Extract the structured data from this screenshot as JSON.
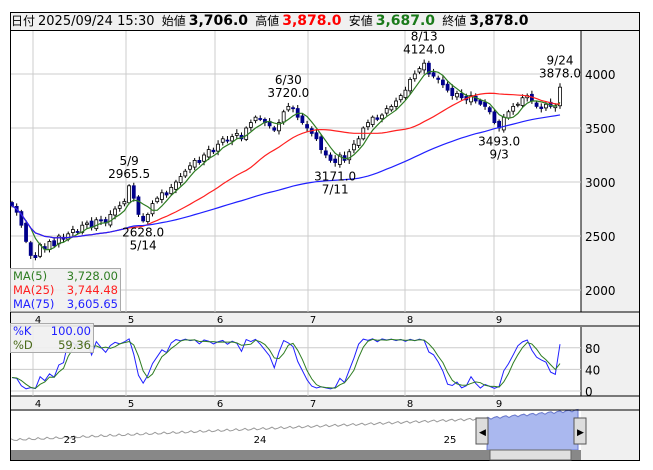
{
  "header": {
    "date_label": "日付",
    "datetime": "2025/09/24 15:30",
    "open_label": "始値",
    "open": "3,706.0",
    "high_label": "高値",
    "high": "3,878.0",
    "low_label": "安値",
    "low": "3,687.0",
    "close_label": "終値",
    "close": "3,878.0"
  },
  "colors": {
    "up_fill": "#ffffff",
    "down_fill": "#00008b",
    "ma5": "#2e7d22",
    "ma25": "#ff2020",
    "ma75": "#2020ff",
    "high_text": "#ff0000",
    "low_text": "#1a7a1a",
    "k": "#2020ff",
    "d": "#2e7d22"
  },
  "legend_ma": [
    {
      "label": "MA(5)",
      "value": "3,728.00"
    },
    {
      "label": "MA(25)",
      "value": "3,744.48"
    },
    {
      "label": "MA(75)",
      "value": "3,605.65"
    }
  ],
  "legend_stoch": [
    {
      "label": "%K",
      "value": "100.00"
    },
    {
      "label": "%D",
      "value": "59.36"
    }
  ],
  "navigator": {
    "years": [
      "23",
      "24",
      "25"
    ]
  },
  "chart_data": {
    "type": "candlestick",
    "months": [
      "4",
      "5",
      "6",
      "7",
      "8",
      "9"
    ],
    "price_axis": {
      "ticks": [
        2000,
        2500,
        3000,
        3500,
        4000
      ],
      "range": [
        1800,
        4200
      ]
    },
    "stoch_axis": {
      "ticks": [
        0,
        40,
        80
      ],
      "range": [
        0,
        100
      ]
    },
    "closes": [
      2780,
      2720,
      2600,
      2450,
      2320,
      2300,
      2420,
      2380,
      2450,
      2410,
      2500,
      2470,
      2520,
      2560,
      2540,
      2600,
      2620,
      2580,
      2650,
      2640,
      2620,
      2700,
      2750,
      2780,
      2820,
      2965,
      2850,
      2700,
      2640,
      2700,
      2800,
      2850,
      2900,
      2880,
      2950,
      3000,
      3050,
      3100,
      3150,
      3200,
      3180,
      3250,
      3300,
      3280,
      3350,
      3400,
      3380,
      3420,
      3450,
      3400,
      3500,
      3550,
      3600,
      3580,
      3550,
      3520,
      3480,
      3550,
      3650,
      3700,
      3680,
      3600,
      3550,
      3500,
      3450,
      3400,
      3300,
      3250,
      3200,
      3180,
      3250,
      3200,
      3280,
      3350,
      3400,
      3500,
      3550,
      3600,
      3580,
      3620,
      3680,
      3700,
      3750,
      3800,
      3850,
      3950,
      4000,
      4050,
      4100,
      4000,
      3980,
      3950,
      3900,
      3850,
      3800,
      3820,
      3780,
      3760,
      3800,
      3750,
      3720,
      3700,
      3650,
      3550,
      3500,
      3600,
      3650,
      3700,
      3720,
      3780,
      3800,
      3750,
      3700,
      3680,
      3720,
      3700,
      3706,
      3878
    ],
    "annotations": [
      {
        "date": "5/9",
        "value": "2965.5",
        "index": 25,
        "pos": "above"
      },
      {
        "date": "5/14",
        "value": "2628.0",
        "index": 28,
        "pos": "below"
      },
      {
        "date": "6/30",
        "value": "3720.0",
        "index": 59,
        "pos": "above"
      },
      {
        "date": "7/11",
        "value": "3171.0",
        "index": 69,
        "pos": "below"
      },
      {
        "date": "8/13",
        "value": "4124.0",
        "index": 88,
        "pos": "above"
      },
      {
        "date": "9/3",
        "value": "3493.0",
        "index": 104,
        "pos": "below"
      },
      {
        "date": "9/24",
        "value": "3878.0",
        "index": 117,
        "pos": "above"
      }
    ]
  }
}
